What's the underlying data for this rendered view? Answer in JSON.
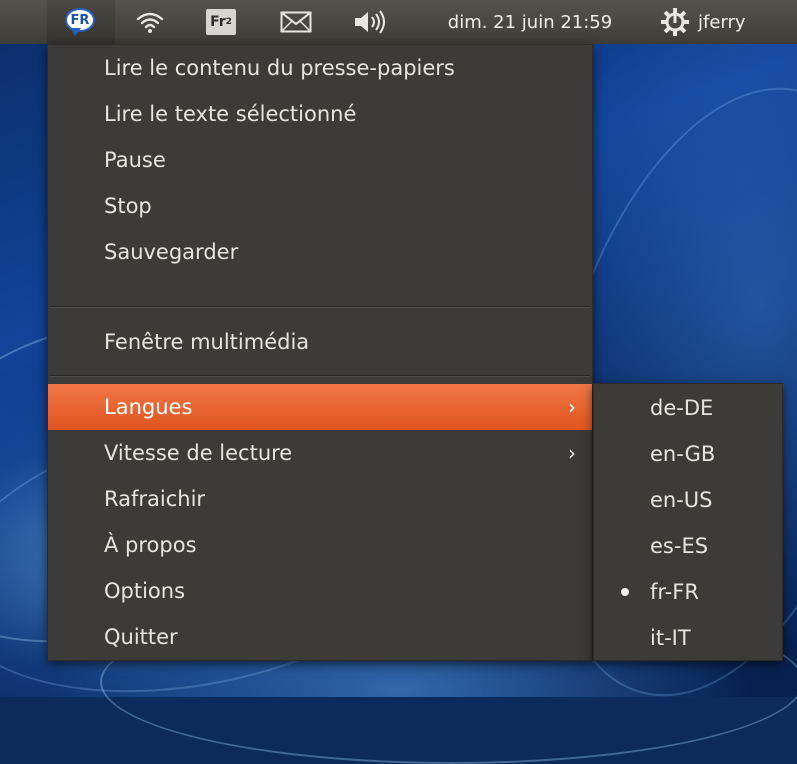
{
  "panel": {
    "indicator_label": "FR",
    "fr2_label": "Fr",
    "fr2_sub": "2",
    "clock": "dim. 21 juin 21:59",
    "user": "jferry",
    "icons": [
      "speech-bubble-icon",
      "wifi-icon",
      "fr2-icon",
      "mail-icon",
      "volume-icon",
      "power-gear-icon"
    ]
  },
  "menu": {
    "items": [
      {
        "label": "Lire le contenu du presse-papiers"
      },
      {
        "label": "Lire le texte sélectionné"
      },
      {
        "label": "Pause"
      },
      {
        "label": "Stop"
      },
      {
        "label": "Sauvegarder"
      },
      {
        "label": "Fenêtre multimédia"
      },
      {
        "label": "Langues",
        "submenu_arrow": "›"
      },
      {
        "label": "Vitesse de lecture",
        "submenu_arrow": "›"
      },
      {
        "label": "Rafraichir"
      },
      {
        "label": "À propos"
      },
      {
        "label": "Options"
      },
      {
        "label": "Quitter"
      }
    ],
    "highlighted": "Langues"
  },
  "submenu": {
    "items": [
      {
        "label": "de-DE"
      },
      {
        "label": "en-GB"
      },
      {
        "label": "en-US"
      },
      {
        "label": "es-ES"
      },
      {
        "label": "fr-FR",
        "selected": true
      },
      {
        "label": "it-IT"
      }
    ]
  },
  "colors": {
    "panel_bg": "#484640",
    "menu_bg": "#3c3b37",
    "highlight": "#e9652f",
    "text": "#e6e4de"
  }
}
